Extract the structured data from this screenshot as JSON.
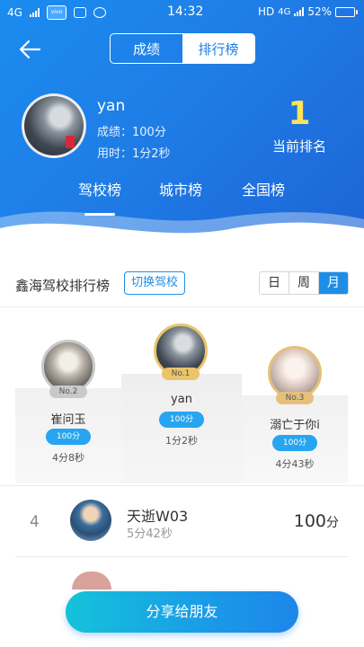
{
  "status": {
    "network": "4G",
    "app_chip": "vivo",
    "time": "14:32",
    "hd": "HD",
    "network_right": "4G",
    "battery": "52%"
  },
  "header": {
    "segments": [
      "成绩",
      "排行榜"
    ],
    "active_segment": "排行榜",
    "user": {
      "name": "yan",
      "score_line": "成绩：100分",
      "time_line": "用时：1分2秒"
    },
    "rank_number": "1",
    "rank_label": "当前排名",
    "subtabs": [
      "驾校榜",
      "城市榜",
      "全国榜"
    ],
    "active_subtab": "驾校榜"
  },
  "ranking": {
    "title": "鑫海驾校排行榜",
    "switch_label": "切换驾校",
    "periods": [
      "日",
      "周",
      "月"
    ],
    "active_period": "月"
  },
  "podium": [
    {
      "badge": "No.1",
      "name": "yan",
      "score": "100分",
      "time": "1分2秒"
    },
    {
      "badge": "No.2",
      "name": "崔问玉",
      "score": "100分",
      "time": "4分8秒"
    },
    {
      "badge": "No.3",
      "name": "溺亡于你i",
      "score": "100分",
      "time": "4分43秒"
    }
  ],
  "list": [
    {
      "rank": "4",
      "name": "天逝W03",
      "time": "5分42秒",
      "score": "100",
      "unit": "分"
    }
  ],
  "share_label": "分享给朋友",
  "colors": {
    "header_blue": "#1f7de6",
    "accent_blue": "#1d8ee8",
    "rank_yellow": "#ffe25a",
    "score_pill": "#27a5f0",
    "gold_badge": "#e9c46a",
    "silver_badge": "#c9c9c9",
    "bronze_badge": "#e6c07a"
  }
}
